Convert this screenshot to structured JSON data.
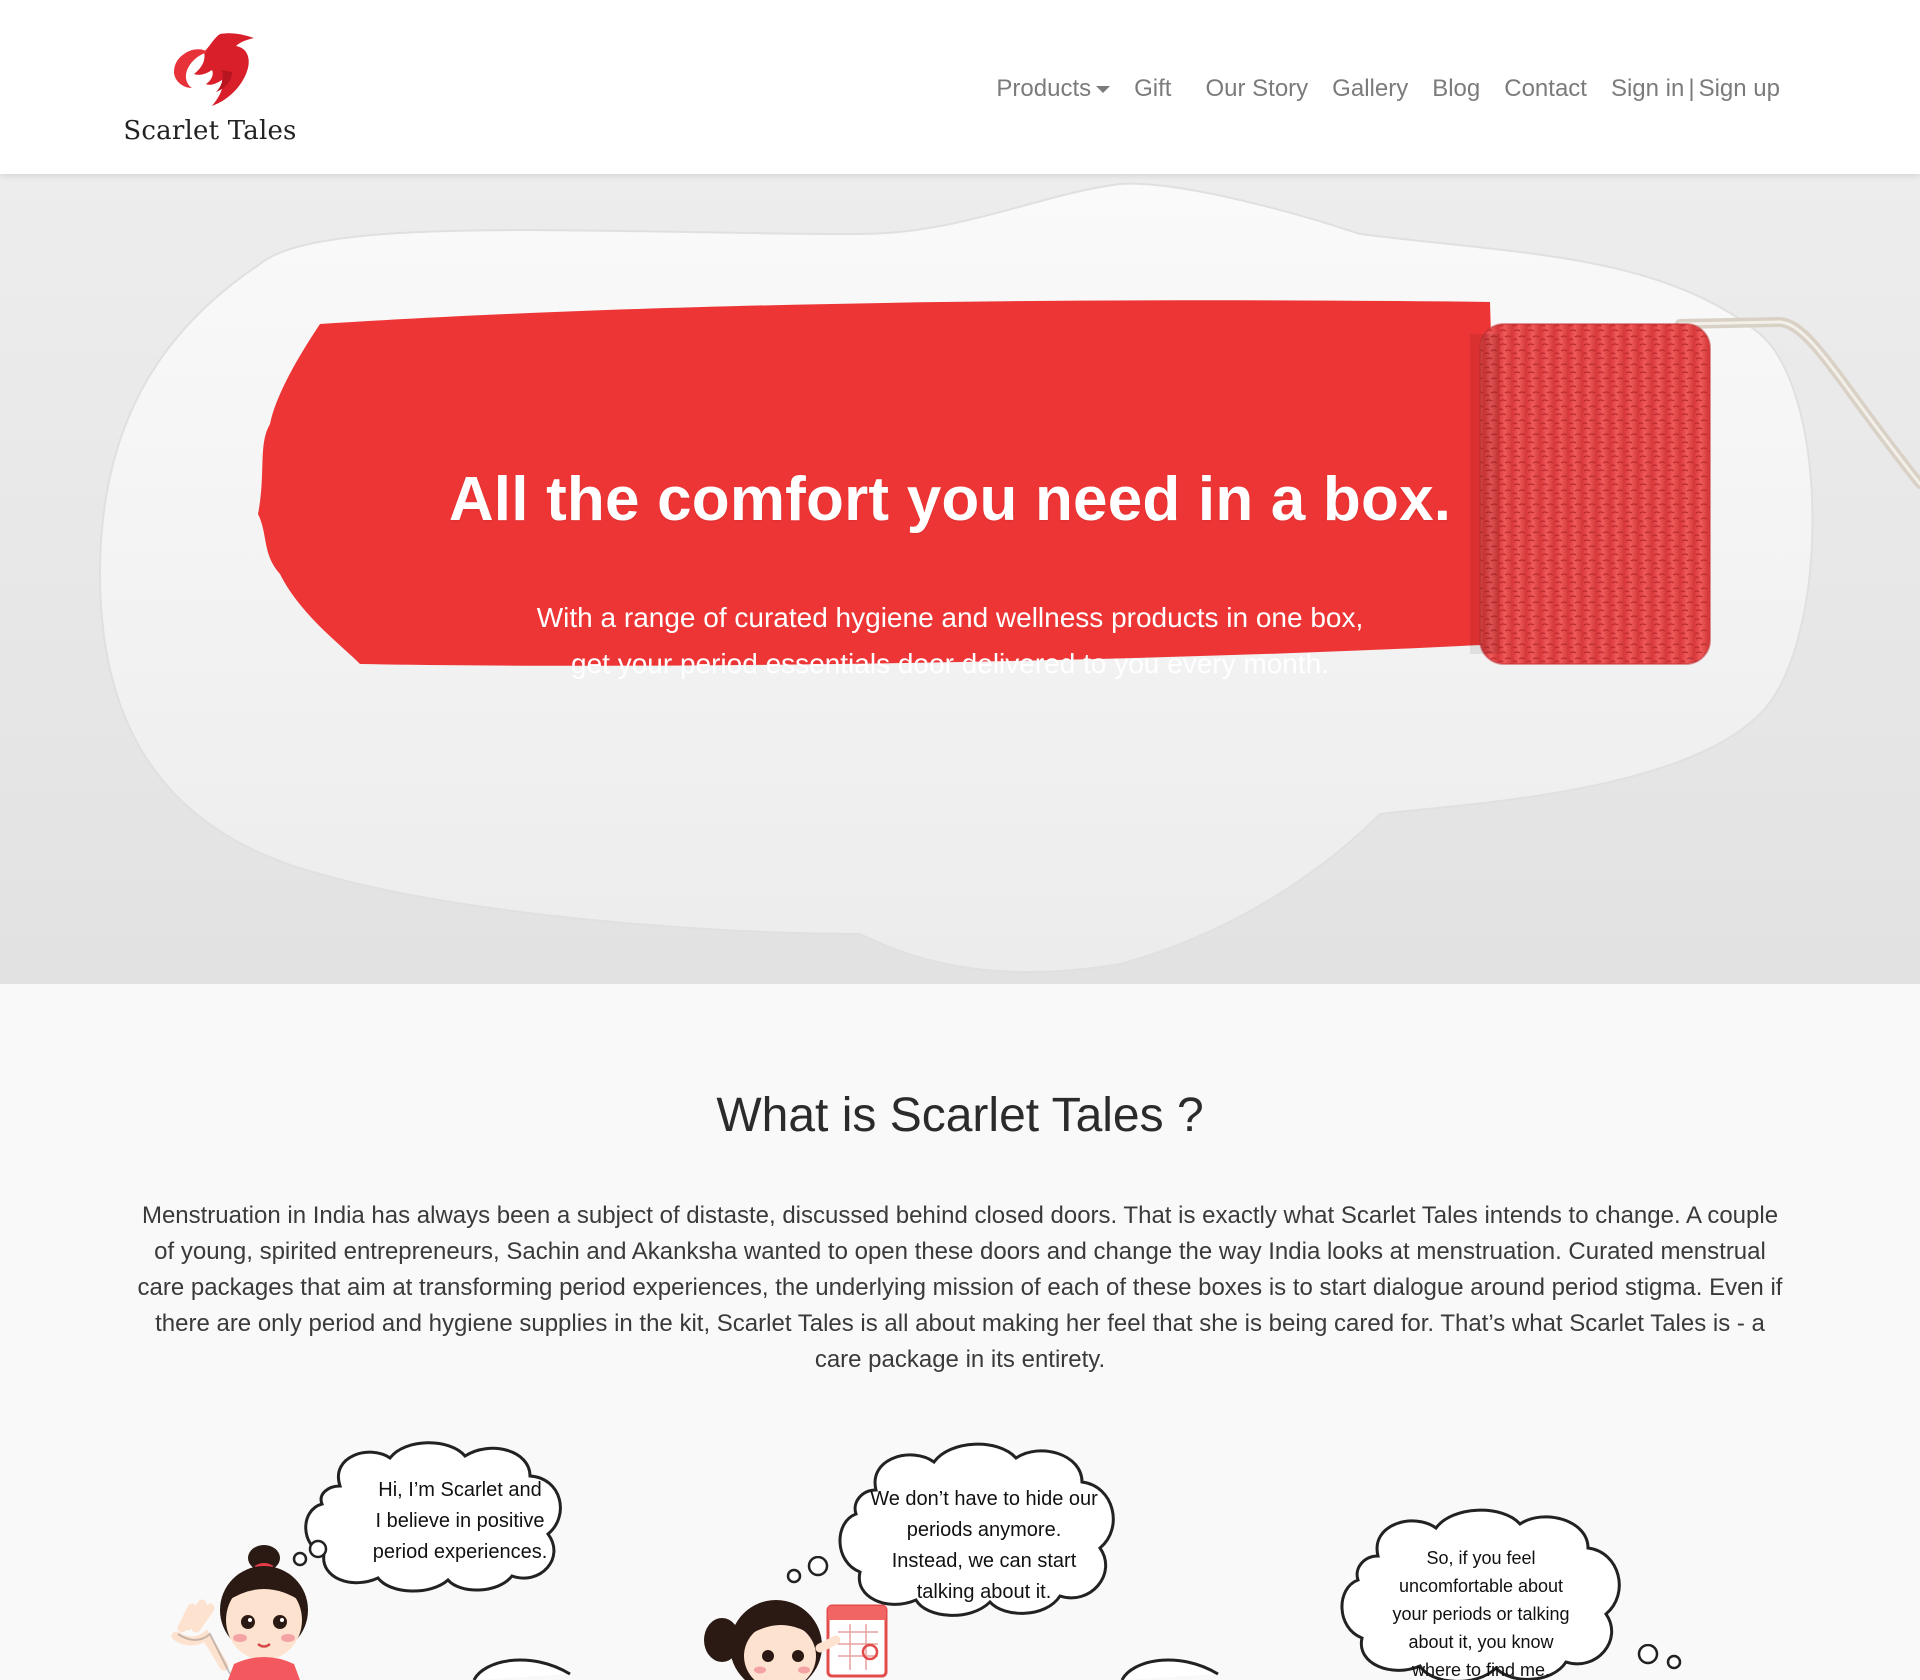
{
  "brand": {
    "name": "Scarlet Tales",
    "logo_icon": "red-silhouette-icon",
    "accent_color": "#e52d2d"
  },
  "nav": {
    "products": "Products",
    "gift": "Gift",
    "our_story": "Our Story",
    "gallery": "Gallery",
    "blog": "Blog",
    "contact": "Contact",
    "sign_in": "Sign in",
    "separator": "|",
    "sign_up": "Sign up"
  },
  "hero": {
    "title": "All the comfort you need in a box.",
    "subtitle_line1": "With a range of curated hygiene and wellness products in one box,",
    "subtitle_line2": "get your period essentials door delivered to you every month.",
    "paint_color": "#ee3535"
  },
  "about": {
    "title": "What is Scarlet Tales ?",
    "body": "Menstruation in India has always been a subject of distaste, discussed behind closed doors. That is exactly what Scarlet Tales intends to change. A couple of young, spirited entrepreneurs, Sachin and Akanksha wanted to open these doors and change the way India looks at menstruation. Curated menstrual care packages that aim at transforming period experiences, the underlying mission of each of these boxes is to start dialogue around period stigma. Even if there are only period and hygiene supplies in the kit, Scarlet Tales is all about making her feel that she is being cared for. That’s what Scarlet Tales is - a care package in its entirety."
  },
  "bubbles": [
    {
      "lines": [
        "Hi, I’m Scarlet and",
        "I believe in positive",
        "period experiences."
      ]
    },
    {
      "lines": [
        "We don’t have to hide our",
        "periods anymore.",
        "Instead, we can start",
        "talking about it."
      ]
    },
    {
      "lines": [
        "So, if you feel",
        "uncomfortable about",
        "your periods or talking",
        "about it, you know",
        "where to find me."
      ]
    }
  ]
}
